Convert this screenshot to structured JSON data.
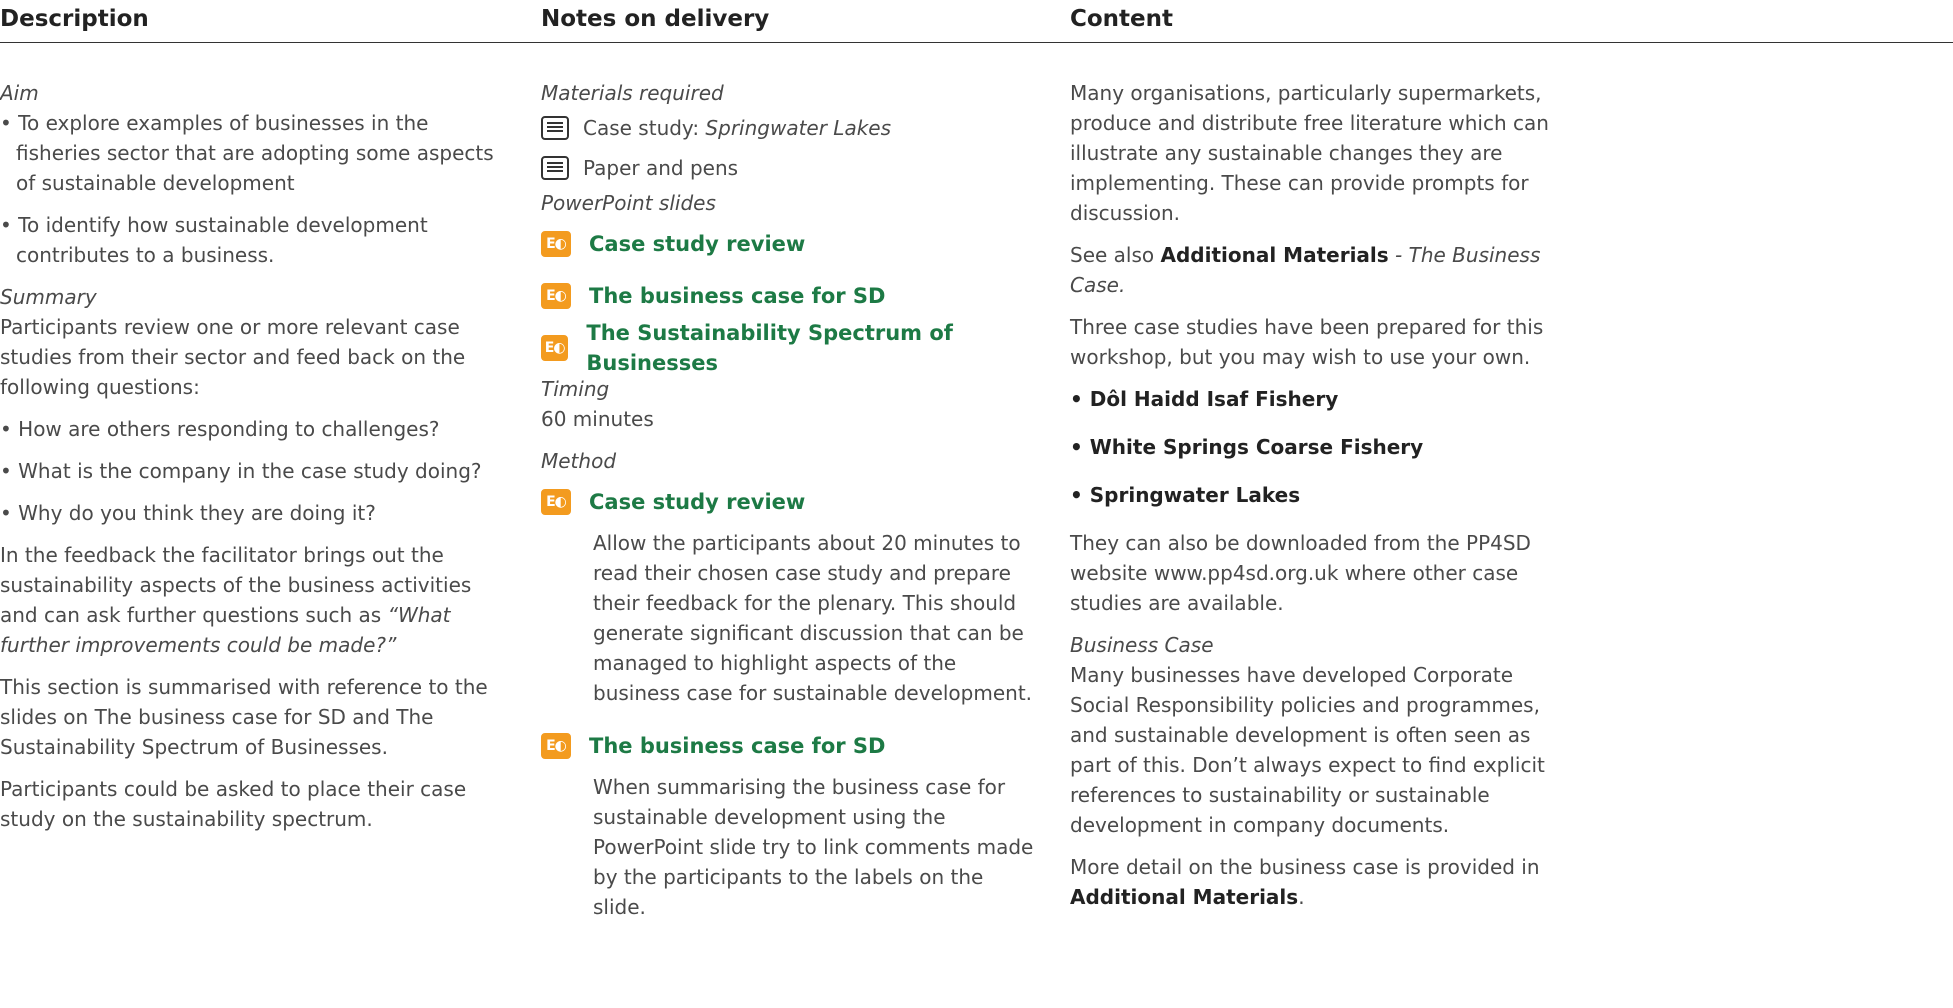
{
  "header": {
    "description": "Description",
    "notes": "Notes on delivery",
    "content": "Content"
  },
  "description": {
    "aim_heading": "Aim",
    "aim_bullets": [
      "To explore examples of businesses in the fisheries sector that are adopting some aspects of sustainable development",
      "To identify how sustainable development contributes to a business."
    ],
    "summary_heading": "Summary",
    "summary_text": "Participants review one or more relevant case studies from their sector and feed back on the following questions:",
    "questions": [
      "How are others responding to challenges?",
      "What is the company in the case study doing?",
      "Why do you think they are doing it?"
    ],
    "feedback_text": "In the feedback the facilitator brings out the sustainability aspects of the business activities and can ask further questions such as",
    "feedback_quote": "“What further improvements could be made?”",
    "section_text": "This section is summarised with reference to the slides on The business case for SD and The Sustainability Spectrum of Businesses.",
    "participants_text": "Participants could be asked to place their case study on the sustainability spectrum."
  },
  "notes": {
    "materials_heading": "Materials required",
    "material1_prefix": "Case study: ",
    "material1_title": "Springwater Lakes",
    "material2": "Paper and pens",
    "ppt_heading": "PowerPoint slides",
    "slides": [
      "Case study review",
      "The business case for SD",
      "The Sustainability Spectrum of Businesses"
    ],
    "timing_heading": "Timing",
    "timing": "60 minutes",
    "method_heading": "Method",
    "method1_label": "Case study review",
    "method1_text": "Allow the participants about 20 minutes to read their chosen case study and prepare their feedback for the plenary. This should generate significant discussion that can be managed to highlight aspects of the business case for sustainable development.",
    "method2_label": "The business case for SD",
    "method2_text": "When summarising the business case for sustainable development using the PowerPoint slide try to link comments made by the participants to the labels on the slide."
  },
  "content": {
    "intro": "Many organisations, particularly supermarkets, produce and distribute free literature which can illustrate any sustainable changes they are implementing. These can provide prompts for discussion.",
    "see_also_prefix": "See also ",
    "see_also_bold": "Additional Materials",
    "see_also_suffix": " - The Business Case.",
    "three_cases": "Three case studies have been prepared for this workshop, but you may wish to use your own.",
    "cases": [
      "Dôl Haidd Isaf Fishery",
      "White Springs Coarse Fishery",
      "Springwater Lakes"
    ],
    "download_text": "They can also be downloaded from the PP4SD website www.pp4sd.org.uk where other case studies are available.",
    "business_case_heading": "Business Case",
    "business_case_text": "Many businesses have developed Corporate Social Responsibility policies and programmes, and sustainable development is often seen as part of this. Don’t always expect to find explicit references to sustainability or sustainable development in company documents.",
    "more_detail_prefix": "More detail on the business case is provided in",
    "more_detail_bold": "Additional Materials",
    "more_detail_suffix": "."
  },
  "colors": {
    "slide_green": "#1d7a45",
    "ppt_orange": "#f39b1f"
  },
  "icons": {
    "document": "document-icon",
    "powerpoint": "powerpoint-icon"
  }
}
